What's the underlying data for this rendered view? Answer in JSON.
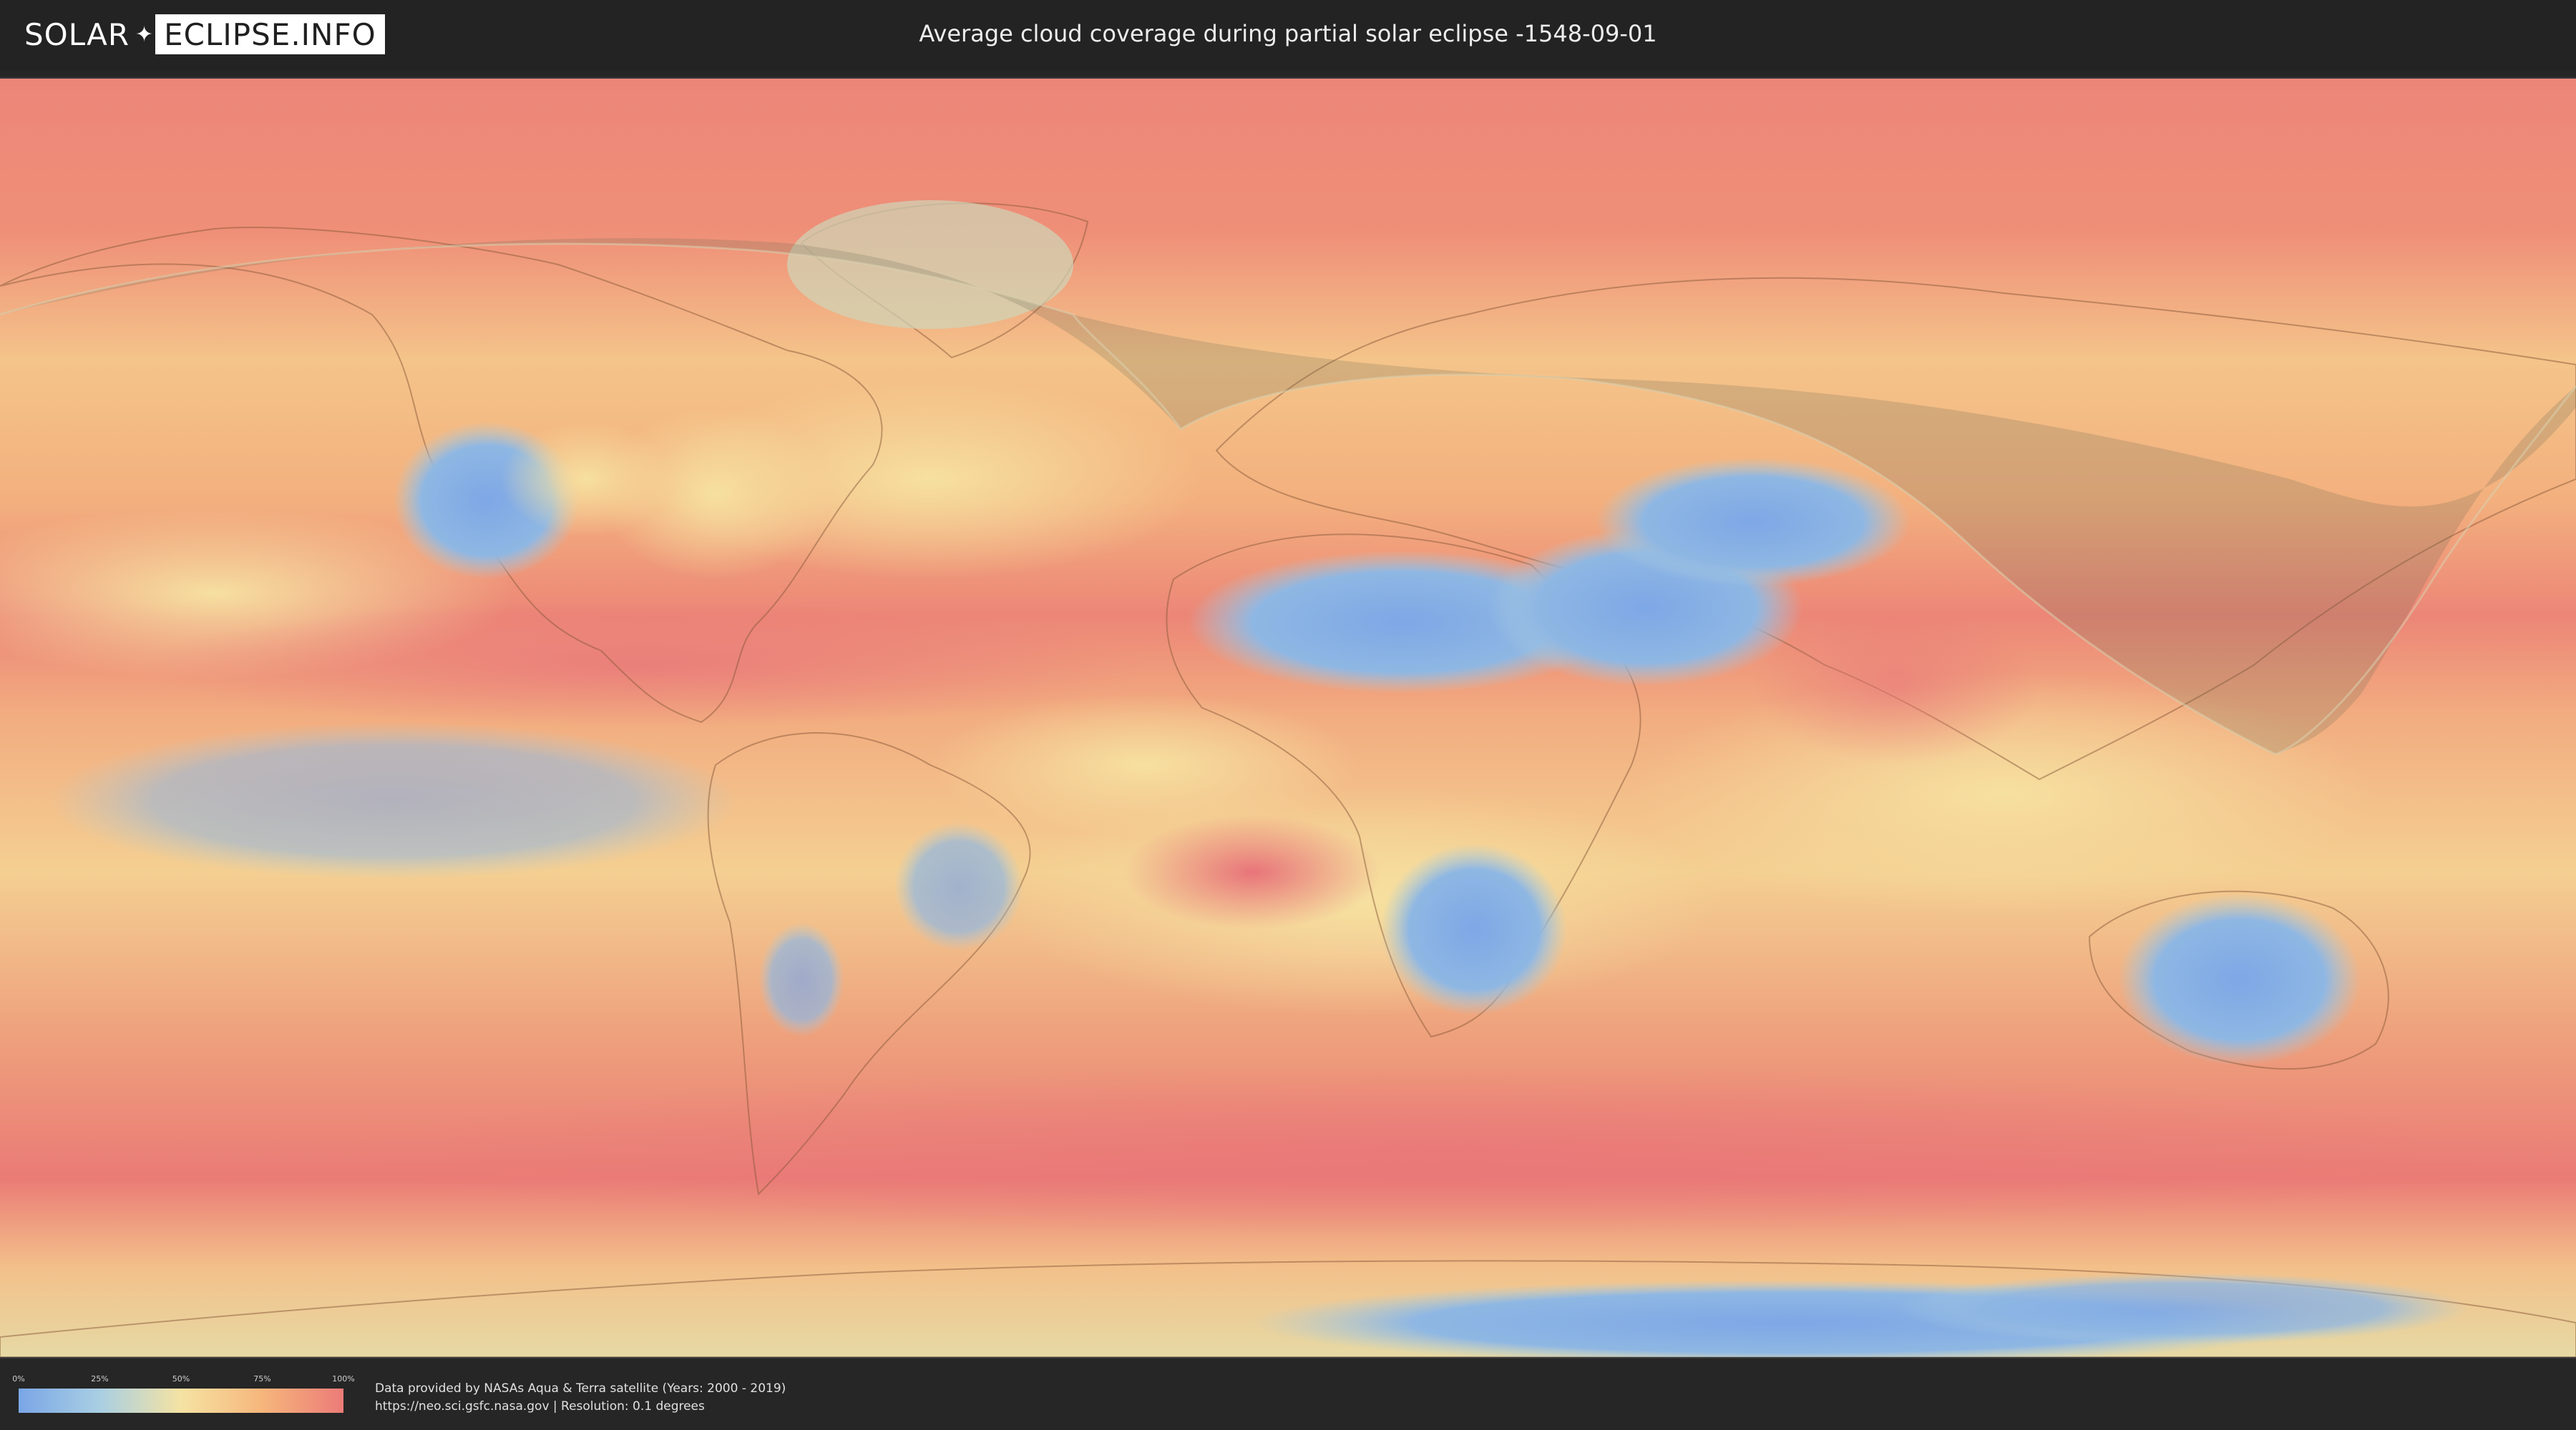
{
  "header": {
    "logo": {
      "left": "SOLAR",
      "mark": "✦",
      "right": "ECLIPSE.INFO"
    },
    "title": "Average cloud coverage during partial solar eclipse -1548-09-01"
  },
  "map": {
    "description_layer": "cloud-coverage",
    "colors": {
      "clear": "#7aa6e6",
      "low": "#a9cfe3",
      "mid": "#f5e3a3",
      "high": "#f6b67c",
      "overcast": "#ec7b78",
      "eclipse_shadow": "#6b6b52"
    }
  },
  "legend": {
    "ticks": [
      "0%",
      "25%",
      "50%",
      "75%",
      "100%"
    ]
  },
  "credits": {
    "line1": "Data provided by NASAs Aqua & Terra satellite (Years: 2000 - 2019)",
    "line2": "https://neo.sci.gsfc.nasa.gov | Resolution: 0.1 degrees"
  }
}
